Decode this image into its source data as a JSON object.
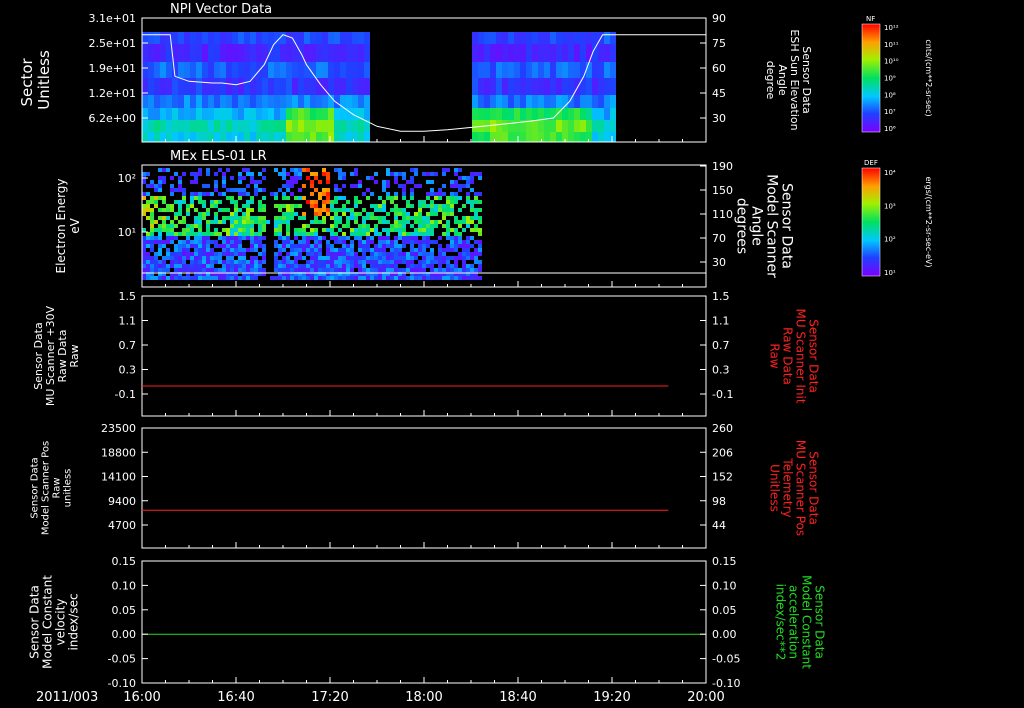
{
  "date_label": "2011/003",
  "time_ticks": [
    "16:00",
    "16:40",
    "17:20",
    "18:00",
    "18:40",
    "19:20",
    "20:00"
  ],
  "colors": {
    "bg": "#000000",
    "axis": "#ffffff",
    "red": "#ff2020",
    "green": "#22dd22"
  },
  "chart_data": [
    {
      "type": "heatmap",
      "title": "NPI Vector Data",
      "ylabel": "Sector\nUnitless",
      "y_ticks": [
        "3.1e+01",
        "2.5e+01",
        "1.9e+01",
        "1.2e+01",
        "6.2e+00"
      ],
      "right_axis": {
        "label": "Sensor Data\nESH Sun Elevation\nAngle\ndegree",
        "ticks": [
          "90",
          "75",
          "60",
          "45",
          "30"
        ],
        "range": [
          15,
          90
        ]
      },
      "overlay_series": {
        "name": "ESH Sun Elevation Angle",
        "x_minutes": [
          0,
          8,
          12,
          14,
          20,
          30,
          34,
          40,
          46,
          52,
          56,
          60,
          64,
          68,
          70,
          76,
          82,
          90,
          100,
          110,
          120,
          130,
          145,
          165,
          175,
          182,
          188,
          192,
          196,
          206,
          220,
          240
        ],
        "values": [
          80,
          80,
          80,
          55,
          52,
          51,
          51,
          50,
          52,
          62,
          74,
          80,
          78,
          68,
          62,
          50,
          40,
          32,
          25,
          22,
          22,
          23,
          25,
          28,
          30,
          40,
          55,
          70,
          80,
          80,
          80,
          80
        ]
      },
      "colorbar": {
        "label": "NF",
        "units": "cnts/(cm**2-sr-sec)",
        "ticks": [
          "10¹²",
          "10¹¹",
          "10¹⁰",
          "10⁹",
          "10⁸",
          "10⁷",
          "10⁶"
        ]
      }
    },
    {
      "type": "heatmap",
      "title": "MEx ELS-01 LR",
      "ylabel": "Electron Energy\neV",
      "y_ticks": [
        "10²",
        "10¹"
      ],
      "right_axis": {
        "label": "Sensor Data\nModel Scanner\nAngle\ndegrees",
        "ticks": [
          "190",
          "150",
          "110",
          "70",
          "30"
        ],
        "range": [
          0,
          190
        ]
      },
      "overlay_series": {
        "name": "Model Scanner Angle",
        "values_const": 8
      },
      "colorbar": {
        "label": "DEF",
        "units": "ergs/(cm**2-sr-sec-eV)",
        "ticks": [
          "10⁴",
          "10³",
          "10²",
          "10¹"
        ]
      }
    },
    {
      "type": "line",
      "ylabel": "Sensor Data\nMU Scanner +30V\nRaw Data\nRaw",
      "y_ticks": [
        "1.5",
        "1.1",
        "0.7",
        "0.3",
        "-0.1"
      ],
      "ylim": [
        -0.5,
        1.5
      ],
      "right_axis": {
        "label": "Sensor Data\nMU Scanner Init\nRaw Data\nRaw",
        "ticks": [
          "1.5",
          "1.1",
          "0.7",
          "0.3",
          "-0.1"
        ]
      },
      "series": [
        {
          "x_minutes_end": 224,
          "value": 0.0,
          "color": "#ff2020"
        }
      ]
    },
    {
      "type": "line",
      "ylabel": "Sensor Data\nModel Scanner Pos\nRaw\nunitless",
      "y_ticks": [
        "23500",
        "18800",
        "14100",
        "9400",
        "4700"
      ],
      "ylim": [
        0,
        23500
      ],
      "right_axis": {
        "label": "Sensor Data\nMU Scanner Pos\nTelemetry\nUnitless",
        "ticks": [
          "260",
          "206",
          "152",
          "98",
          "44"
        ]
      },
      "series": [
        {
          "x_minutes_end": 224,
          "value": 7400,
          "color": "#ff2020"
        }
      ]
    },
    {
      "type": "line",
      "ylabel": "Sensor Data\nModel Constant\nvelocity\nindex/sec",
      "y_ticks": [
        "0.15",
        "0.10",
        "0.05",
        "0.00",
        "-0.05",
        "-0.10"
      ],
      "ylim": [
        -0.1,
        0.15
      ],
      "right_axis": {
        "label": "Sensor Data\nModel Constant\nacceleration\nindex/sec**2",
        "ticks": [
          "0.15",
          "0.10",
          "0.05",
          "0.00",
          "-0.05",
          "-0.10"
        ]
      },
      "series": [
        {
          "x_minutes_end": 240,
          "value": 0.0,
          "color": "#22dd22"
        }
      ]
    }
  ]
}
